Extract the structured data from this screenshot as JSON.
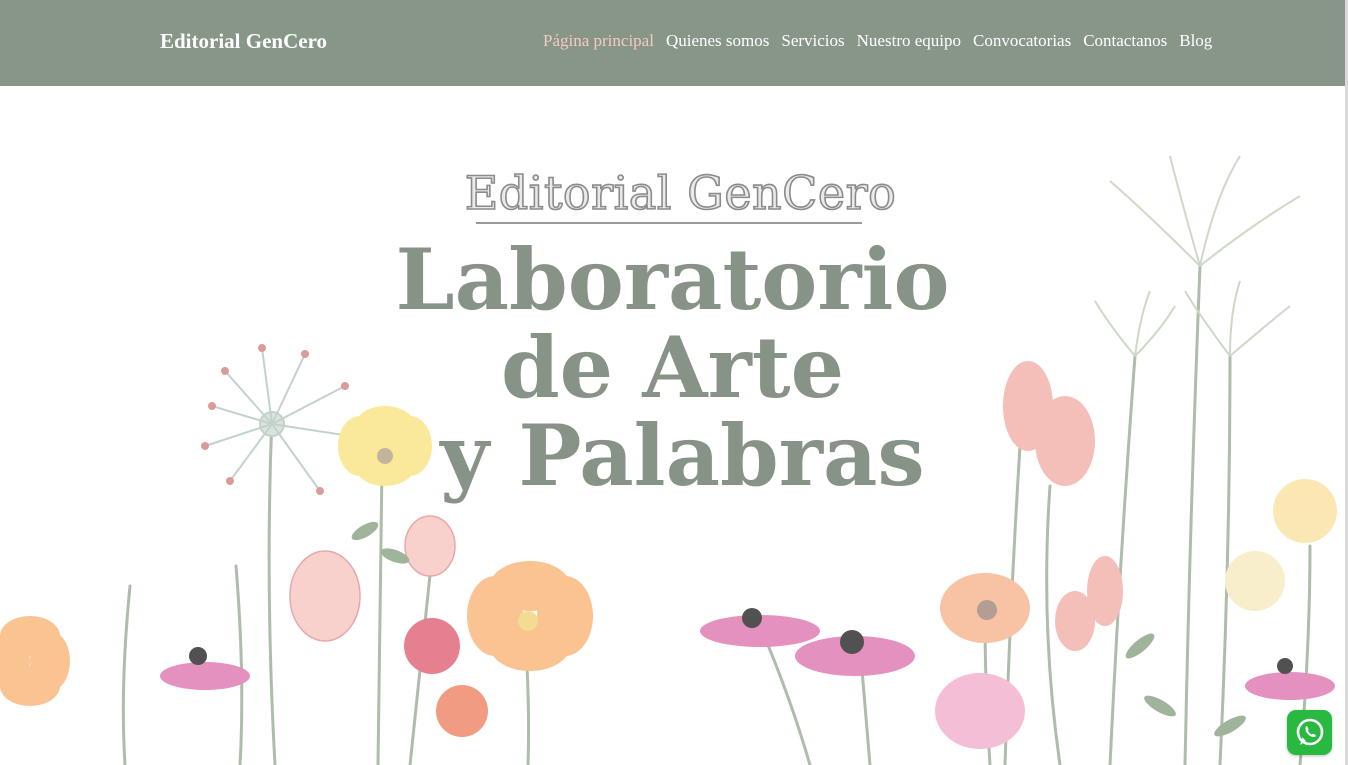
{
  "navbar": {
    "brand": "Editorial GenCero",
    "items": [
      {
        "label": "Página principal",
        "active": true
      },
      {
        "label": "Quienes somos"
      },
      {
        "label": "Servicios"
      },
      {
        "label": "Nuestro equipo"
      },
      {
        "label": "Convocatorias"
      },
      {
        "label": "Contactanos"
      },
      {
        "label": "Blog"
      }
    ],
    "background": "#889688",
    "active_color": "#f3c9c9"
  },
  "hero": {
    "brand": "Editorial GenCero",
    "line1": "Laboratorio",
    "line2": "de Arte",
    "line3": "y Palabras",
    "title_color": "#879386"
  },
  "floating": {
    "icon": "whatsapp-icon",
    "color": "#2ab940"
  }
}
